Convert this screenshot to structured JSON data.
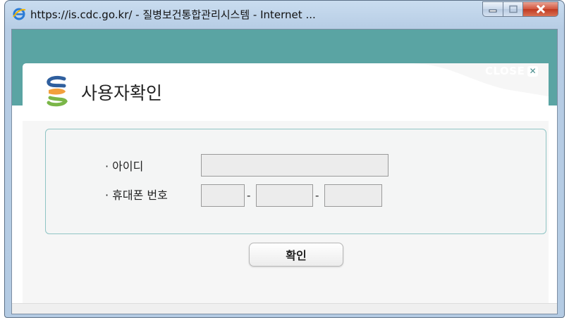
{
  "window": {
    "title": "https://is.cdc.go.kr/ - 질병보건통합관리시스템 - Internet ...",
    "icons": {
      "app": "ie-icon",
      "minimize": "minimize-icon",
      "maximize": "maximize-icon",
      "close": "close-icon"
    },
    "colors": {
      "frame": "#b7cde5",
      "close_button": "#c8462c"
    }
  },
  "popup": {
    "close_label": "CLOSE",
    "heading": "사용자확인",
    "logo_icon": "cdc-logo-icon",
    "colors": {
      "accent_teal": "#5aa4a3",
      "logo_blue": "#2f5f9e",
      "logo_orange": "#f2a03d",
      "logo_green": "#7ab648"
    }
  },
  "form": {
    "id_label": "· 아이디",
    "id_value": "",
    "phone_label": "· 휴대폰 번호",
    "phone_separator": "-",
    "phone_part1": "",
    "phone_part2": "",
    "phone_part3": ""
  },
  "actions": {
    "confirm_label": "확인"
  }
}
